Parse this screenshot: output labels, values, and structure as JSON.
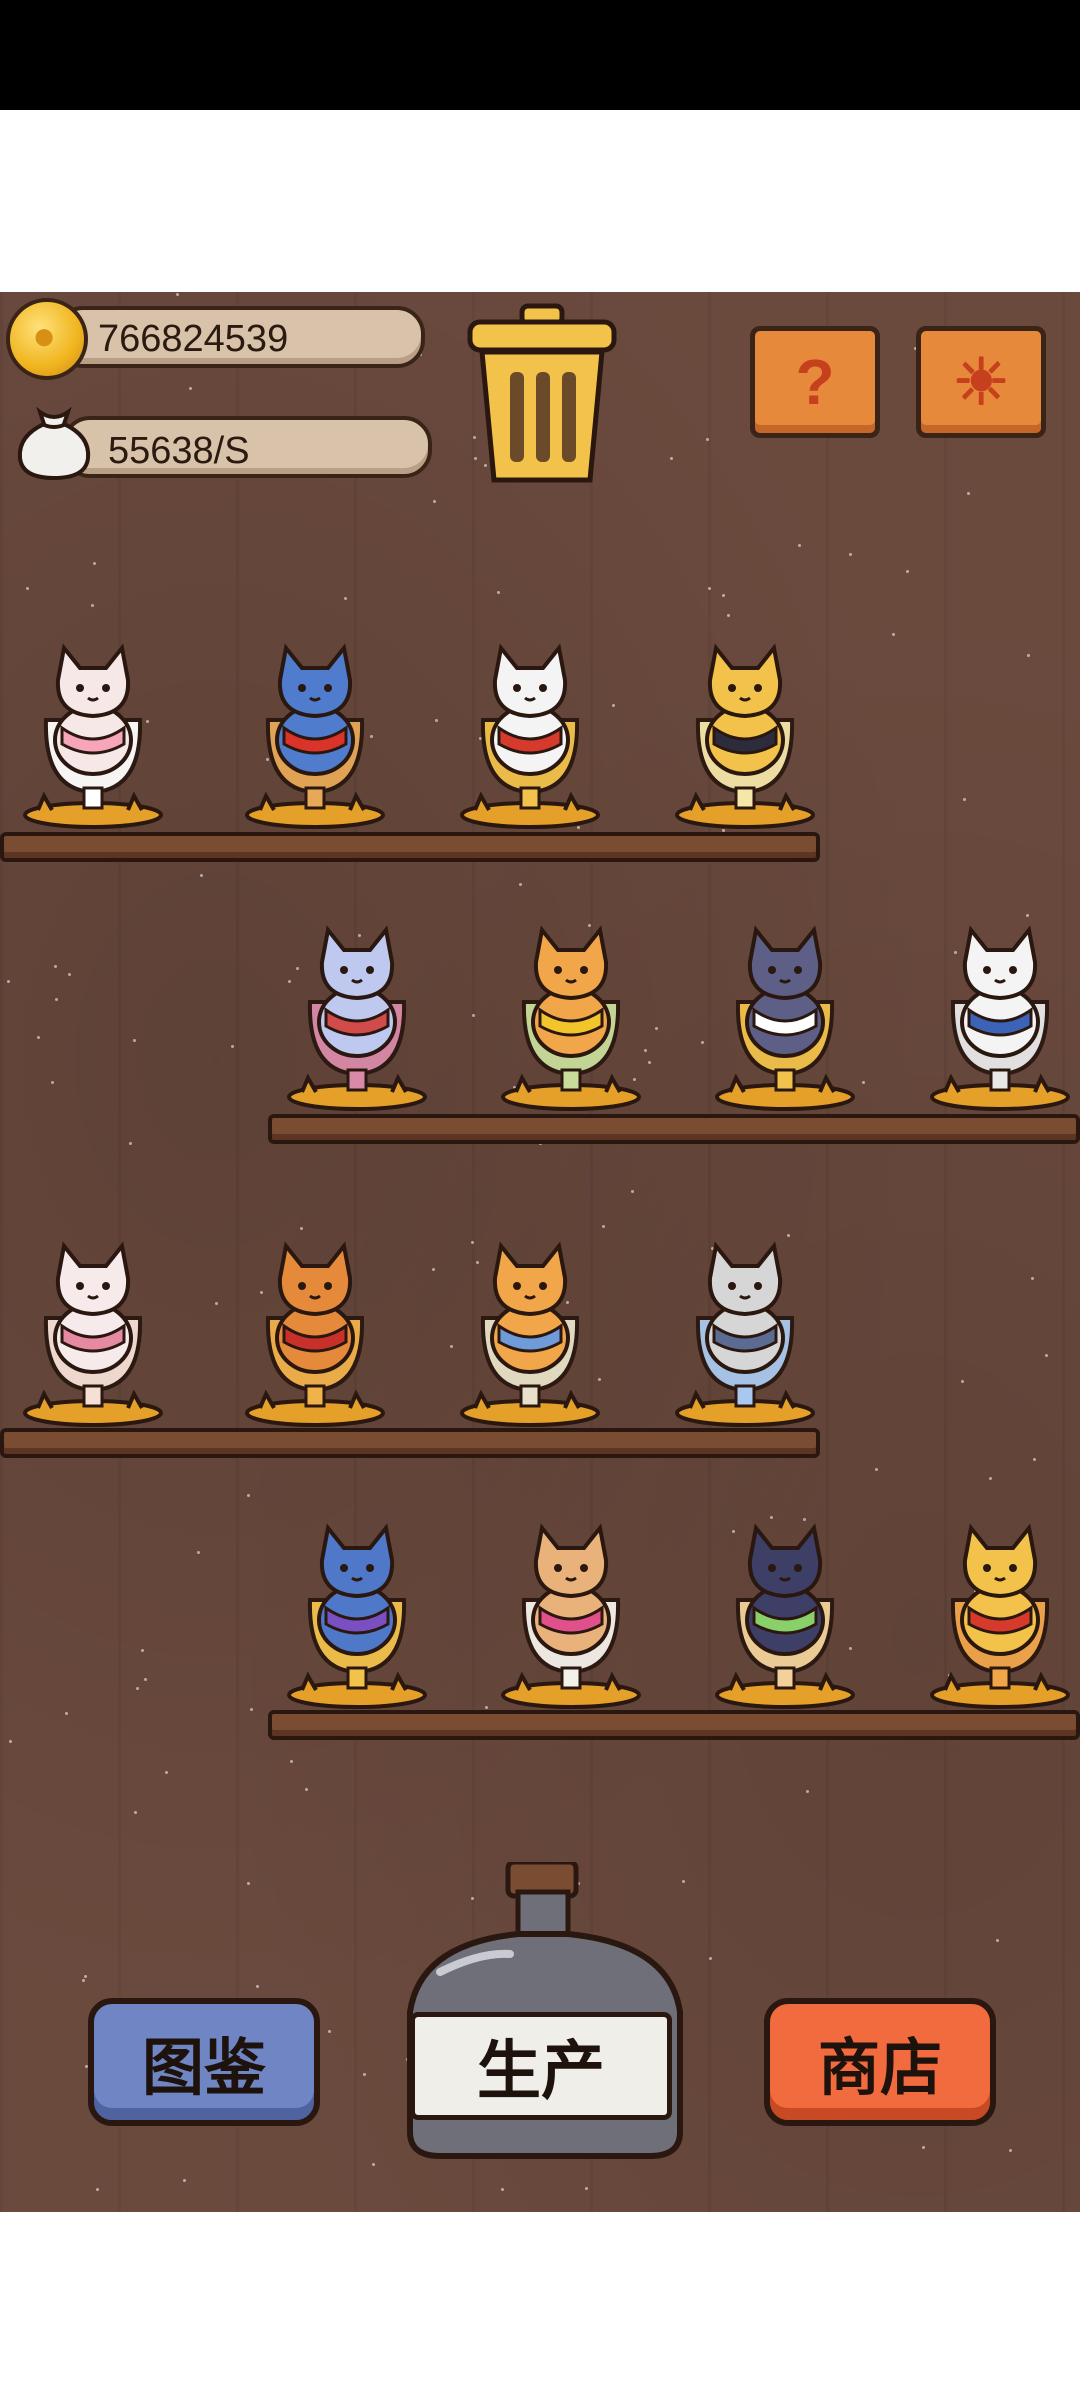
{
  "resources": {
    "coins": "766824539",
    "income_rate": "55638/S"
  },
  "buttons": {
    "help_icon": "?",
    "settings_icon": "☀",
    "collection_label": "图鉴",
    "produce_label": "生产",
    "shop_label": "商店"
  },
  "icons": {
    "coin": "coin-icon",
    "money_bag": "money-bag-icon",
    "trash": "trash-can-icon",
    "help": "question-icon",
    "settings": "gear-icon"
  },
  "shelves": [
    {
      "row": 1,
      "cats": [
        {
          "name": "pink-cat-in-bowl",
          "body": "#f7e8e8",
          "accent": "#f6a6b8",
          "cup": "#ffffff"
        },
        {
          "name": "blue-cat-in-layered-mug",
          "body": "#4f7ccc",
          "accent": "#d9332a",
          "cup": "#e7a957"
        },
        {
          "name": "calico-cat-red-jacket",
          "body": "#f4f4f4",
          "accent": "#d63a2c",
          "cup": "#f2c24a"
        },
        {
          "name": "yellow-cat-in-goblet",
          "body": "#f2c24a",
          "accent": "#2c2c3c",
          "cup": "#f6e6a8"
        }
      ]
    },
    {
      "row": 2,
      "cats": [
        {
          "name": "lavender-cat-in-glass",
          "body": "#bfc8ee",
          "accent": "#d24b4b",
          "cup": "#d98aa8"
        },
        {
          "name": "orange-cat-with-sunflower",
          "body": "#f2a64a",
          "accent": "#f2c62a",
          "cup": "#c9dd9a"
        },
        {
          "name": "two-cats-in-beer-mug",
          "body": "#5e5f86",
          "accent": "#ffffff",
          "cup": "#f2c24a"
        },
        {
          "name": "white-cat-in-blue-robe",
          "body": "#f4f4f4",
          "accent": "#3d63b8",
          "cup": "#e8e8e8"
        }
      ]
    },
    {
      "row": 3,
      "cats": [
        {
          "name": "white-cat-with-lute",
          "body": "#f7eaea",
          "accent": "#e68aa2",
          "cup": "#f6e0d6"
        },
        {
          "name": "cat-with-red-hood",
          "body": "#e58a3a",
          "accent": "#c8302a",
          "cup": "#f2b24a"
        },
        {
          "name": "orange-cat-blue-cloak",
          "body": "#f2a64a",
          "accent": "#6f9bd8",
          "cup": "#e8e0c8"
        },
        {
          "name": "grey-cat-in-blue-cup",
          "body": "#d6d6d6",
          "accent": "#5b6b92",
          "cup": "#a9c8ee"
        }
      ]
    },
    {
      "row": 4,
      "cats": [
        {
          "name": "wizard-cat-in-beer",
          "body": "#4f78c8",
          "accent": "#7a4fc2",
          "cup": "#f2c24a"
        },
        {
          "name": "tabby-cat-pink-scarf",
          "body": "#e9b27a",
          "accent": "#e0508a",
          "cup": "#f4f0ea"
        },
        {
          "name": "black-cat-in-tall-glass",
          "body": "#3d3f66",
          "accent": "#8ad06a",
          "cup": "#f2d29a"
        },
        {
          "name": "yellow-cat-red-robe",
          "body": "#f2c24a",
          "accent": "#d63a2c",
          "cup": "#f2a64a"
        }
      ]
    }
  ]
}
